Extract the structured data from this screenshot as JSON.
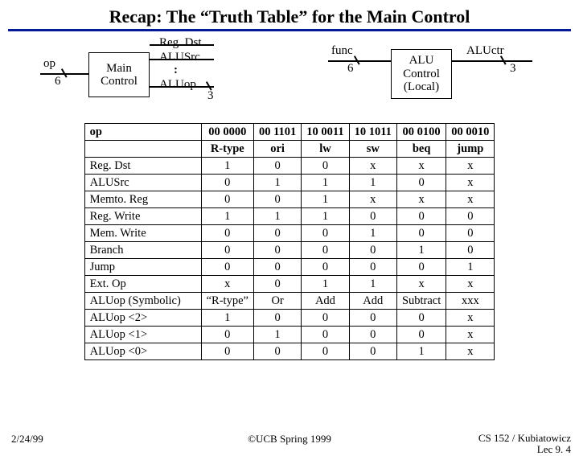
{
  "title": "Recap: The “Truth Table” for the Main Control",
  "diagram": {
    "op_label": "op",
    "op_width": "6",
    "main_control": "Main\nControl",
    "sig_regdst": "Reg. Dst",
    "sig_alusrc": "ALUSrc",
    "sig_dots": ":",
    "sig_aluop": "ALUop",
    "aluop_width": "3",
    "func_label": "func",
    "func_width": "6",
    "alu_control": "ALU\nControl\n(Local)",
    "aluctr_label": "ALUctr",
    "aluctr_width": "3"
  },
  "table": {
    "head_row1": [
      "op",
      "00 0000",
      "00 1101",
      "10 0011",
      "10 1011",
      "00 0100",
      "00 0010"
    ],
    "head_row2": [
      "",
      "R-type",
      "ori",
      "lw",
      "sw",
      "beq",
      "jump"
    ],
    "rows": [
      {
        "name": "Reg. Dst",
        "v": [
          "1",
          "0",
          "0",
          "x",
          "x",
          "x"
        ]
      },
      {
        "name": "ALUSrc",
        "v": [
          "0",
          "1",
          "1",
          "1",
          "0",
          "x"
        ]
      },
      {
        "name": "Memto. Reg",
        "v": [
          "0",
          "0",
          "1",
          "x",
          "x",
          "x"
        ]
      },
      {
        "name": "Reg. Write",
        "v": [
          "1",
          "1",
          "1",
          "0",
          "0",
          "0"
        ]
      },
      {
        "name": "Mem. Write",
        "v": [
          "0",
          "0",
          "0",
          "1",
          "0",
          "0"
        ]
      },
      {
        "name": "Branch",
        "v": [
          "0",
          "0",
          "0",
          "0",
          "1",
          "0"
        ]
      },
      {
        "name": "Jump",
        "v": [
          "0",
          "0",
          "0",
          "0",
          "0",
          "1"
        ]
      },
      {
        "name": "Ext. Op",
        "v": [
          "x",
          "0",
          "1",
          "1",
          "x",
          "x"
        ]
      },
      {
        "name": "ALUop (Symbolic)",
        "v": [
          "“R-type”",
          "Or",
          "Add",
          "Add",
          "Subtract",
          "xxx"
        ]
      },
      {
        "name": "ALUop <2>",
        "v": [
          "1",
          "0",
          "0",
          "0",
          "0",
          "x"
        ]
      },
      {
        "name": "ALUop <1>",
        "v": [
          "0",
          "1",
          "0",
          "0",
          "0",
          "x"
        ]
      },
      {
        "name": "ALUop <0>",
        "v": [
          "0",
          "0",
          "0",
          "0",
          "1",
          "x"
        ]
      }
    ]
  },
  "footer": {
    "date": "2/24/99",
    "mid": "©UCB Spring 1999",
    "right1": "CS 152 / Kubiatowicz",
    "right2": "Lec 9. 4"
  }
}
